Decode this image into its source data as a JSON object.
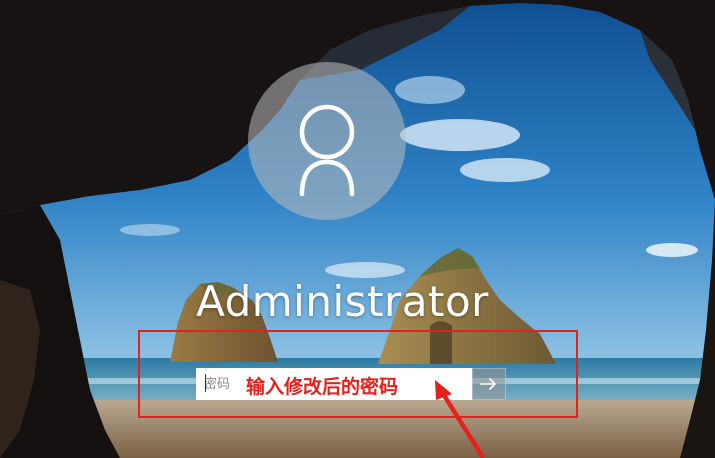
{
  "user": {
    "name": "Administrator"
  },
  "password": {
    "placeholder": "密码",
    "value": ""
  },
  "annotation": {
    "text": "输入修改后的密码",
    "color": "#e5211d"
  },
  "icons": {
    "avatar": "user-icon",
    "submit": "arrow-right-icon"
  },
  "colors": {
    "sky": "#1f6fb4",
    "sea": "#2f7fa6",
    "sand": "#c9a67a",
    "rock": "#171414"
  }
}
